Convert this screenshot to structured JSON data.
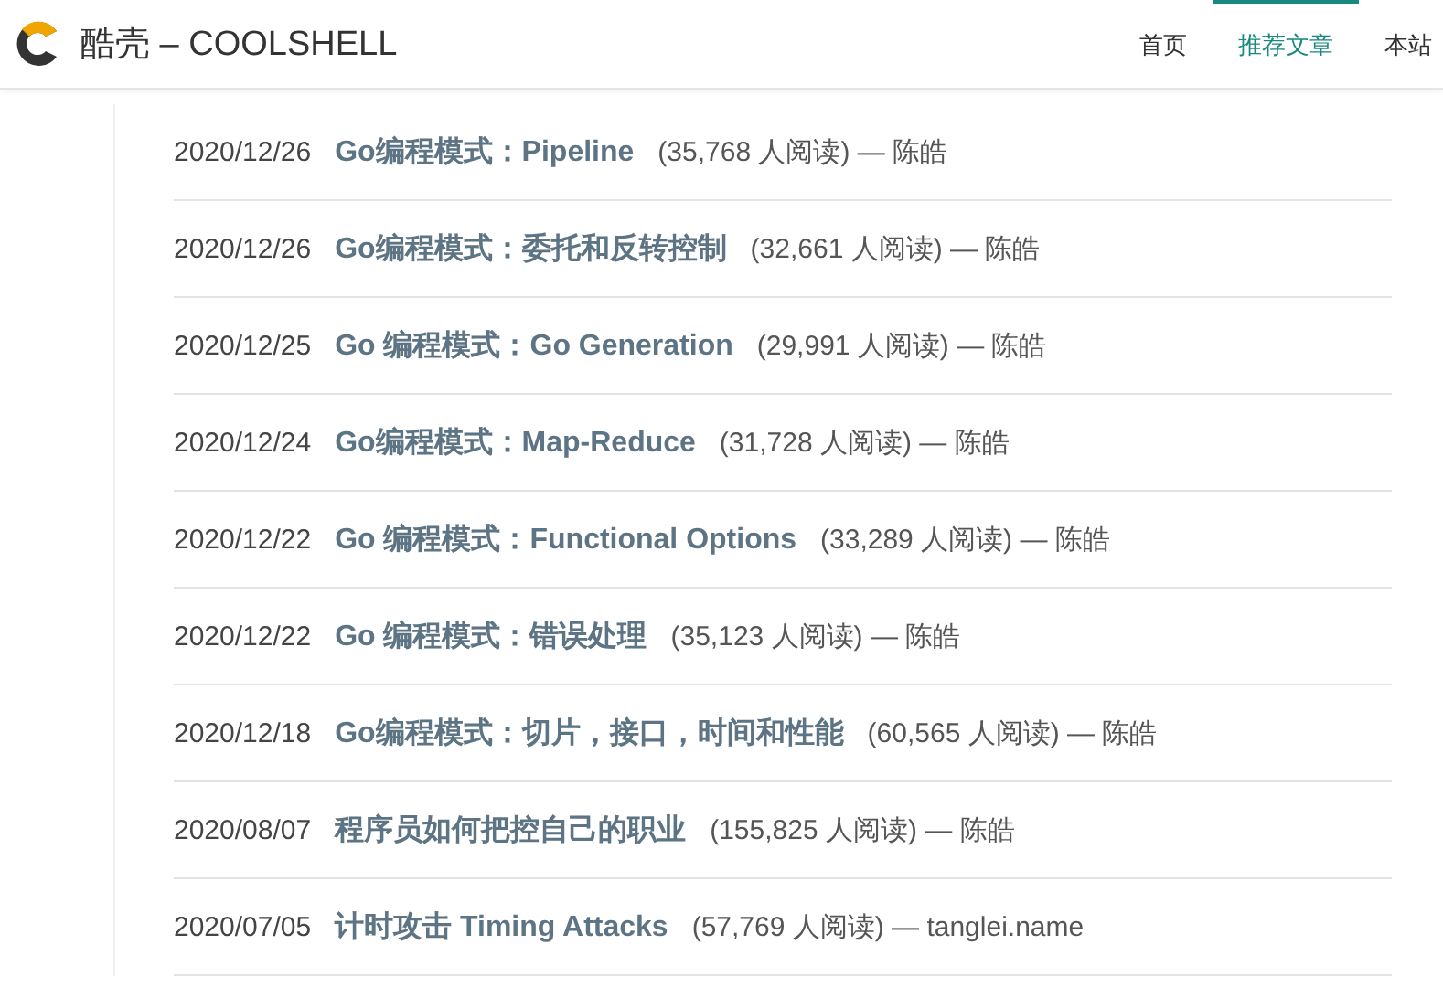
{
  "header": {
    "site_title": "酷壳 – COOLSHELL",
    "nav": [
      {
        "label": "首页",
        "selected": false
      },
      {
        "label": "推荐文章",
        "selected": true
      },
      {
        "label": "本站",
        "selected": false
      }
    ]
  },
  "articles": [
    {
      "date": "2020/12/26",
      "title": "Go编程模式：Pipeline",
      "meta": "(35,768 人阅读) — 陈皓"
    },
    {
      "date": "2020/12/26",
      "title": "Go编程模式：委托和反转控制",
      "meta": "(32,661 人阅读) — 陈皓"
    },
    {
      "date": "2020/12/25",
      "title": "Go 编程模式：Go Generation",
      "meta": "(29,991 人阅读) — 陈皓"
    },
    {
      "date": "2020/12/24",
      "title": "Go编程模式：Map-Reduce",
      "meta": "(31,728 人阅读) — 陈皓"
    },
    {
      "date": "2020/12/22",
      "title": "Go 编程模式：Functional Options",
      "meta": "(33,289 人阅读) — 陈皓"
    },
    {
      "date": "2020/12/22",
      "title": "Go 编程模式：错误处理",
      "meta": "(35,123 人阅读) — 陈皓"
    },
    {
      "date": "2020/12/18",
      "title": "Go编程模式：切片，接口，时间和性能",
      "meta": "(60,565 人阅读) — 陈皓"
    },
    {
      "date": "2020/08/07",
      "title": "程序员如何把控自己的职业",
      "meta": "(155,825 人阅读) — 陈皓"
    },
    {
      "date": "2020/07/05",
      "title": "计时攻击 Timing Attacks",
      "meta": "(57,769 人阅读) — tanglei.name"
    }
  ]
}
